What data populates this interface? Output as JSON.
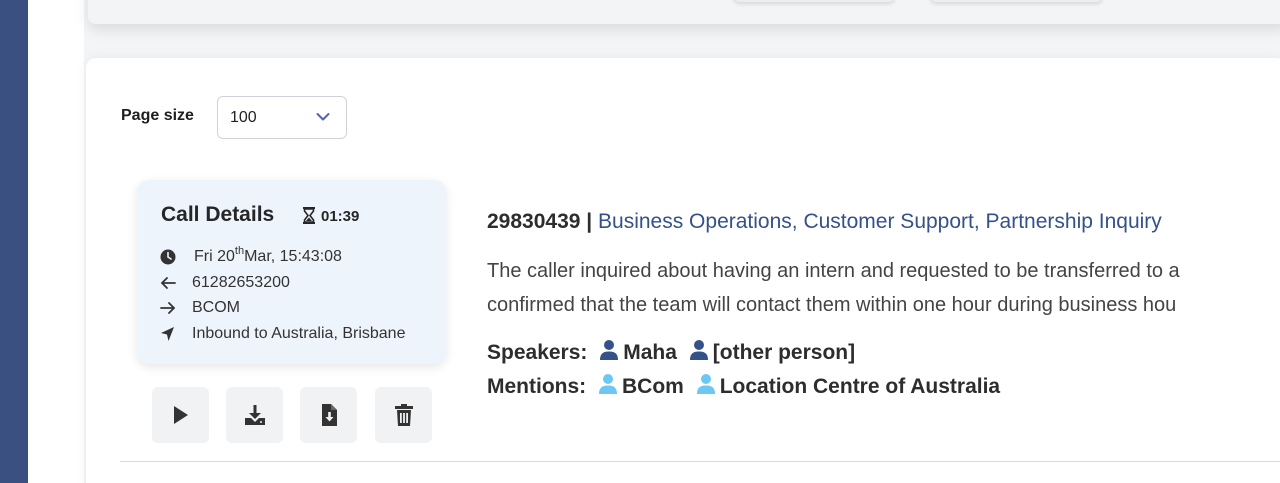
{
  "colors": {
    "sidebar": "#3a5080",
    "accent_link": "#34518a",
    "speaker_icon": "#34518a",
    "mention_icon": "#6cc8f2",
    "chevron": "#5561b8"
  },
  "pagination": {
    "page_size_label": "Page size",
    "page_size_value": "100"
  },
  "call_card": {
    "title": "Call Details",
    "duration": "01:39",
    "date_prefix": "Fri 20",
    "date_suffix": "th",
    "date_rest": "Mar, 15:43:08",
    "from_number": "61282653200",
    "to": "BCOM",
    "direction": "Inbound to Australia, Brisbane",
    "icons": {
      "duration": "hourglass-icon",
      "date": "clock-icon",
      "from": "arrow-left-icon",
      "to": "arrow-right-icon",
      "direction": "location-arrow-icon"
    }
  },
  "actions": [
    {
      "name": "play-button",
      "icon": "play-icon"
    },
    {
      "name": "download-audio-button",
      "icon": "download-icon"
    },
    {
      "name": "download-file-button",
      "icon": "file-download-icon"
    },
    {
      "name": "delete-button",
      "icon": "trash-icon"
    }
  ],
  "call": {
    "id": "29830439",
    "separator": "|",
    "topics": "Business Operations, Customer Support, Partnership Inquiry",
    "summary_line1": "The caller inquired about having an intern and requested to be transferred to a",
    "summary_line2": "confirmed that the team will contact them within one hour during business hou",
    "speakers_label": "Speakers:",
    "speakers": [
      "Maha",
      "[other person]"
    ],
    "mentions_label": "Mentions:",
    "mentions": [
      "BCom",
      "Location Centre of Australia"
    ]
  }
}
